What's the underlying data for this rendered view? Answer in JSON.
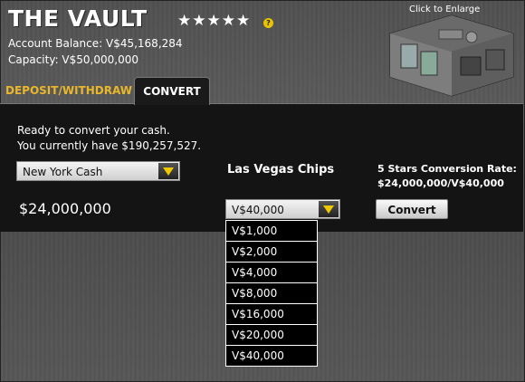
{
  "header": {
    "title": "THE VAULT",
    "stars": "★★★★★",
    "help_icon_text": "?",
    "balance": "Account Balance: V$45,168,284",
    "capacity": "Capacity: V$50,000,000",
    "thumbnail_label": "Click to Enlarge"
  },
  "tabs": [
    {
      "label": "DEPOSIT/WITHDRAW",
      "active": false
    },
    {
      "label": "CONVERT",
      "active": true
    }
  ],
  "convert": {
    "ready_text": "Ready to convert your cash.",
    "have_text": "You currently have $190,257,527.",
    "cash_select": "New York Cash",
    "amount": "$24,000,000",
    "chips_label": "Las Vegas Chips",
    "chips_select": "V$40,000",
    "rate_label": "5 Stars Conversion Rate:",
    "rate_value": "$24,000,000/V$40,000",
    "convert_button": "Convert",
    "options": [
      "V$1,000",
      "V$2,000",
      "V$4,000",
      "V$8,000",
      "V$16,000",
      "V$20,000",
      "V$40,000"
    ]
  },
  "colors": {
    "accent_yellow": "#e9b72c",
    "arrow_yellow": "#f0c800",
    "panel_black": "#141414"
  }
}
